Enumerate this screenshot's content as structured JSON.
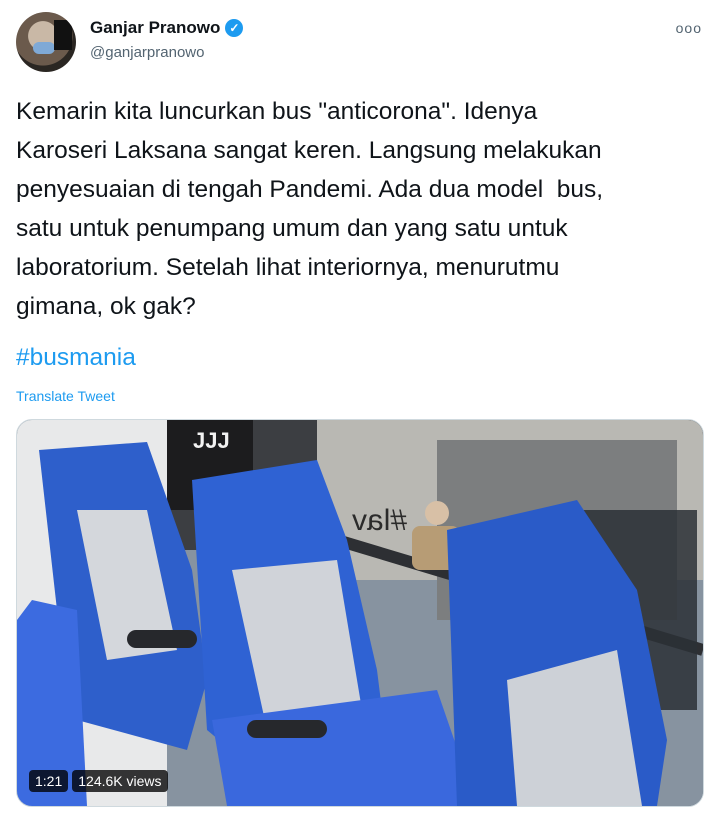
{
  "author": {
    "display_name": "Ganjar Pranowo",
    "handle": "@ganjarpranowo",
    "verified_icon": "✓"
  },
  "tweet": {
    "text": "Kemarin kita luncurkan bus \"anticorona\". Idenya\nKaroseri Laksana sangat keren. Langsung melakukan\npenyesuaian di tengah Pandemi. Ada dua model  bus,\nsatu untuk penumpang umum dan yang satu untuk\nlaboratorium. Setelah lihat interiornya, menurutmu\ngimana, ok gak?",
    "hashtag": "#busmania",
    "translate_label": "Translate Tweet"
  },
  "video": {
    "duration": "1:21",
    "views": "124.6K views",
    "window_text": "#lav",
    "sign_text": "JJJ"
  },
  "more_icon": "ooo",
  "colors": {
    "accent": "#1d9bf0",
    "seat_blue": "#2a5fd0",
    "seat_gray": "#c9ced6"
  }
}
